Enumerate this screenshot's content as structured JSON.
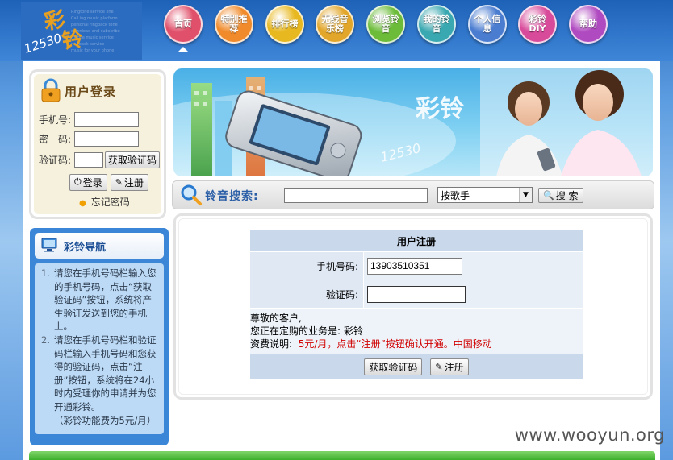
{
  "header": {
    "logo_text": "彩铃12530",
    "nav": [
      {
        "label": "首页",
        "color": "#e0506a",
        "active": true
      },
      {
        "label": "特别推荐",
        "color": "#f08a2a"
      },
      {
        "label": "排行榜",
        "color": "#e8b820"
      },
      {
        "label": "无线音乐榜",
        "color": "#e2a62a"
      },
      {
        "label": "浏览铃音",
        "color": "#6cbc3a"
      },
      {
        "label": "我的铃音",
        "color": "#3aa8b0"
      },
      {
        "label": "个人信息",
        "color": "#4a7cd0"
      },
      {
        "label": "彩铃DIY",
        "color": "#d84a9a"
      },
      {
        "label": "帮助",
        "color": "#b04ac0"
      }
    ]
  },
  "login": {
    "title": "用户登录",
    "phone_label": "手机号:",
    "password_label": "密　码:",
    "code_label": "验证码:",
    "get_code_button": "获取验证码",
    "login_button": "登录",
    "register_button": "注册",
    "forgot_link": "忘记密码"
  },
  "guide": {
    "title": "彩铃导航",
    "steps": [
      {
        "num": "1.",
        "text": "请您在手机号码栏输入您的手机号码，点击“获取验证码”按钮，系统将产生验证发送到您的手机上。"
      },
      {
        "num": "2.",
        "text": "请您在手机号码栏和验证码栏输入手机号码和您获得的验证码，点击“注册”按钮，系统将在24小时内受理你的申请并为您开通彩铃。"
      }
    ],
    "note": "（彩铃功能费为5元/月）"
  },
  "banner": {
    "logo_text": "彩铃",
    "number_text": "12530"
  },
  "search": {
    "title": "铃音搜索:",
    "input_value": "",
    "select_value": "按歌手",
    "button": "搜 索"
  },
  "register": {
    "header": "用户注册",
    "phone_label": "手机号码:",
    "phone_value": "13903510351",
    "code_label": "验证码:",
    "code_value": "",
    "greeting": "尊敬的客户,",
    "business_line": "您正在定购的业务是: 彩铃",
    "fee_label": "资费说明:",
    "fee_text": "5元/月，点击“注册”按钮确认开通。中国移动",
    "get_code_button": "获取验证码",
    "register_button": "注册"
  },
  "watermark": "www.wooyun.org"
}
